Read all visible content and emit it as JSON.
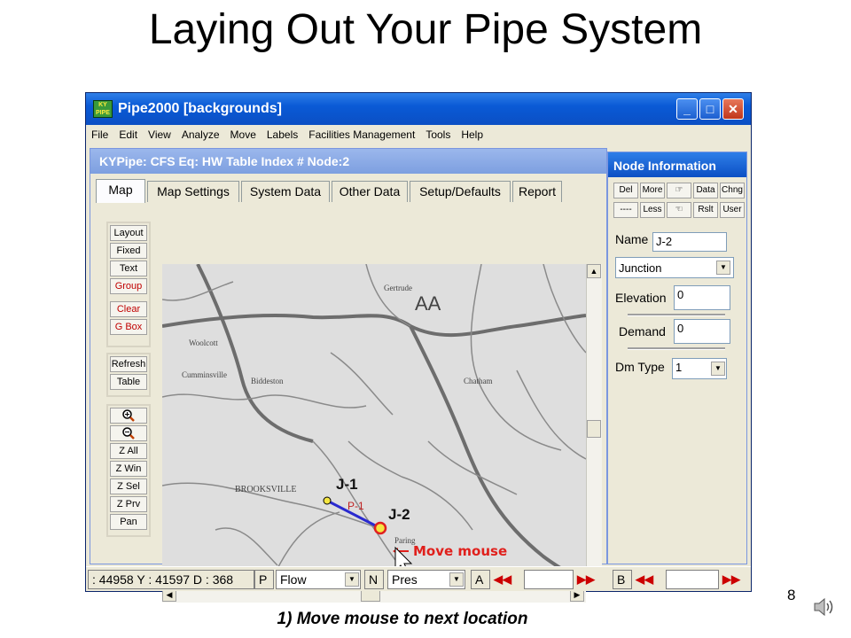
{
  "slide": {
    "title": "Laying Out Your Pipe System",
    "page_number": "8",
    "caption": "1) Move mouse to next location"
  },
  "window": {
    "title": "Pipe2000  [backgrounds]",
    "menu": [
      "File",
      "Edit",
      "View",
      "Analyze",
      "Move",
      "Labels",
      "Facilities Management",
      "Tools",
      "Help"
    ],
    "controls": [
      "minimize",
      "maximize",
      "close"
    ]
  },
  "panel": {
    "title": "KYPipe: CFS  Eq: HW  Table Index #  Node:2",
    "tabs": [
      "Map",
      "Map Settings",
      "System Data",
      "Other Data",
      "Setup/Defaults",
      "Report"
    ],
    "active_tab": "Map",
    "tools_group1": [
      "Layout",
      "Fixed",
      "Text",
      "Group",
      "Clear",
      "G Box"
    ],
    "tools_group2": [
      "Refresh",
      "Table"
    ],
    "tools_group3": [
      "Z All",
      "Z Win",
      "Z Sel",
      "Z Prv",
      "Pan"
    ]
  },
  "map": {
    "labels": [
      "Gertrude",
      "AA",
      "Woolcott",
      "Cumminsville",
      "Biddeston",
      "Chatham",
      "BROOKSVILLE",
      "Paring"
    ],
    "node1": "J-1",
    "node2": "J-2",
    "pipe": "P-1",
    "hint": "Move mouse",
    "colors": {
      "pipe": "#2a2acf",
      "node1": "#f5e642",
      "node2": "#f5e642",
      "node2_ring": "#e02020",
      "hint": "#e0201c"
    }
  },
  "node_info": {
    "title": "Node Information",
    "buttons_row1": [
      "Del",
      "More",
      "",
      "Data",
      "Chng"
    ],
    "buttons_row2": [
      "----",
      "Less",
      "",
      "Rslt",
      "User"
    ],
    "name_label": "Name",
    "name_value": "J-2",
    "type_value": "Junction",
    "elevation_label": "Elevation",
    "elevation_value": "0",
    "demand_label": "Demand",
    "demand_value": "0",
    "dm_type_label": "Dm Type",
    "dm_type_value": "1"
  },
  "status": {
    "coords": ": 44958  Y : 41597   D : 368",
    "p_label": "P",
    "p_value": "Flow",
    "n_label": "N",
    "n_value": "Pres",
    "a_label": "A",
    "b_label": "B"
  }
}
